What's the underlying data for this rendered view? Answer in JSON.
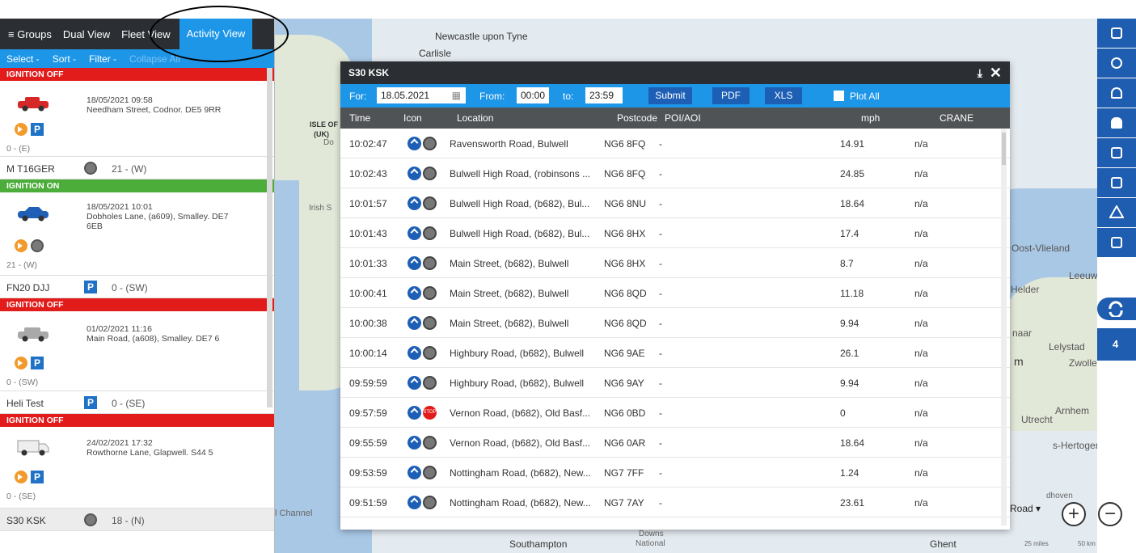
{
  "topbar": {
    "groups": "≡ Groups",
    "dual": "Dual View",
    "fleet": "Fleet View",
    "activity": "Activity View"
  },
  "subbar": {
    "select": "Select -",
    "sort": "Sort -",
    "filter": "Filter -",
    "collapse": "Collapse All"
  },
  "vehicles": [
    {
      "status": "IGNITION OFF",
      "datetime": "18/05/2021 09:58",
      "address": "Needham Street, Codnor. DE5 9RR",
      "speed": "0 - (E)",
      "plate": "M T16GER",
      "plate_value": "21 - (W)",
      "color": "#d62828"
    },
    {
      "status": "IGNITION ON",
      "datetime": "18/05/2021 10:01",
      "address": "Dobholes Lane, (a609), Smalley. DE7",
      "address2": "6EB",
      "speed": "21 - (W)",
      "plate": "FN20 DJJ",
      "plate_value": "0 - (SW)",
      "color": "#1f5fb5"
    },
    {
      "status": "IGNITION OFF",
      "datetime": "01/02/2021 11:16",
      "address": "Main Road, (a608), Smalley. DE7 6",
      "speed": "0 - (SW)",
      "plate": "Heli Test",
      "plate_value": "0 - (SE)",
      "color": "#9a9a9a"
    },
    {
      "status": "IGNITION OFF",
      "datetime": "24/02/2021 17:32",
      "address": "Rowthorne Lane, Glapwell. S44 5",
      "speed": "0 - (SE)",
      "plate": "S30 KSK",
      "plate_value": "18 - (N)",
      "color": "#dddddd"
    }
  ],
  "map_labels": {
    "newcastle": "Newcastle upon Tyne",
    "carlisle": "Carlisle",
    "isle": "ISLE OF MA",
    "uk": "(UK)",
    "irish": "Irish S",
    "do": "Do",
    "vlieland": "Oost-Vlieland",
    "leeuw": "Leeuwa",
    "helder": "Helder",
    "naar": "naar",
    "lelystad": "Lelystad",
    "zwolle": "Zwolle",
    "utrecht": "Utrecht",
    "arnhem": "Arnhem",
    "hertogenbosch": "s-Hertogenbos",
    "channel": "l Channel",
    "southampton": "Southampton",
    "downs": "Downs",
    "national": "National",
    "ghent": "Ghent",
    "road": "Road",
    "scale1": "25 miles",
    "scale2": "50 km",
    "m": "m",
    "hoven": "dhoven"
  },
  "dialog": {
    "title": "S30 KSK",
    "download_icon": "download-icon",
    "close": "✕",
    "for_label": "For:",
    "date": "18.05.2021",
    "from_label": "From:",
    "from_time": "00:00",
    "to_label": "to:",
    "to_time": "23:59",
    "submit": "Submit",
    "pdf": "PDF",
    "xls": "XLS",
    "plot_all": "Plot All",
    "columns": {
      "time": "Time",
      "icon": "Icon",
      "location": "Location",
      "postcode": "Postcode",
      "poi": "POI/AOI",
      "mph": "mph",
      "crane": "CRANE"
    },
    "rows": [
      {
        "time": "10:02:47",
        "location": "Ravensworth Road, Bulwell",
        "postcode": "NG6 8FQ",
        "poi": "-",
        "mph": "14.91",
        "crane": "n/a",
        "stop": false
      },
      {
        "time": "10:02:43",
        "location": "Bulwell High Road, (robinsons ...",
        "postcode": "NG6 8FQ",
        "poi": "-",
        "mph": "24.85",
        "crane": "n/a",
        "stop": false
      },
      {
        "time": "10:01:57",
        "location": "Bulwell High Road, (b682), Bul...",
        "postcode": "NG6 8NU",
        "poi": "-",
        "mph": "18.64",
        "crane": "n/a",
        "stop": false
      },
      {
        "time": "10:01:43",
        "location": "Bulwell High Road, (b682), Bul...",
        "postcode": "NG6 8HX",
        "poi": "-",
        "mph": "17.4",
        "crane": "n/a",
        "stop": false
      },
      {
        "time": "10:01:33",
        "location": "Main Street, (b682), Bulwell",
        "postcode": "NG6 8HX",
        "poi": "-",
        "mph": "8.7",
        "crane": "n/a",
        "stop": false
      },
      {
        "time": "10:00:41",
        "location": "Main Street, (b682), Bulwell",
        "postcode": "NG6 8QD",
        "poi": "-",
        "mph": "11.18",
        "crane": "n/a",
        "stop": false
      },
      {
        "time": "10:00:38",
        "location": "Main Street, (b682), Bulwell",
        "postcode": "NG6 8QD",
        "poi": "-",
        "mph": "9.94",
        "crane": "n/a",
        "stop": false
      },
      {
        "time": "10:00:14",
        "location": "Highbury Road, (b682), Bulwell",
        "postcode": "NG6 9AE",
        "poi": "-",
        "mph": "26.1",
        "crane": "n/a",
        "stop": false
      },
      {
        "time": "09:59:59",
        "location": "Highbury Road, (b682), Bulwell",
        "postcode": "NG6 9AY",
        "poi": "-",
        "mph": "9.94",
        "crane": "n/a",
        "stop": false
      },
      {
        "time": "09:57:59",
        "location": "Vernon Road, (b682), Old Basf...",
        "postcode": "NG6 0BD",
        "poi": "-",
        "mph": "0",
        "crane": "n/a",
        "stop": true
      },
      {
        "time": "09:55:59",
        "location": "Vernon Road, (b682), Old Basf...",
        "postcode": "NG6 0AR",
        "poi": "-",
        "mph": "18.64",
        "crane": "n/a",
        "stop": false
      },
      {
        "time": "09:53:59",
        "location": "Nottingham Road, (b682), New...",
        "postcode": "NG7 7FF",
        "poi": "-",
        "mph": "1.24",
        "crane": "n/a",
        "stop": false
      },
      {
        "time": "09:51:59",
        "location": "Nottingham Road, (b682), New...",
        "postcode": "NG7 7AY",
        "poi": "-",
        "mph": "23.61",
        "crane": "n/a",
        "stop": false
      }
    ]
  },
  "rightbar": {
    "badge": "4",
    "icons": [
      "fullscreen-icon",
      "target-icon",
      "person-pin-icon",
      "bell-icon",
      "document-icon",
      "clipboard-icon",
      "warning-icon",
      "calendar-icon",
      "refresh-icon"
    ]
  },
  "zoom": {
    "plus": "+",
    "minus": "−",
    "road_label": "Road"
  }
}
